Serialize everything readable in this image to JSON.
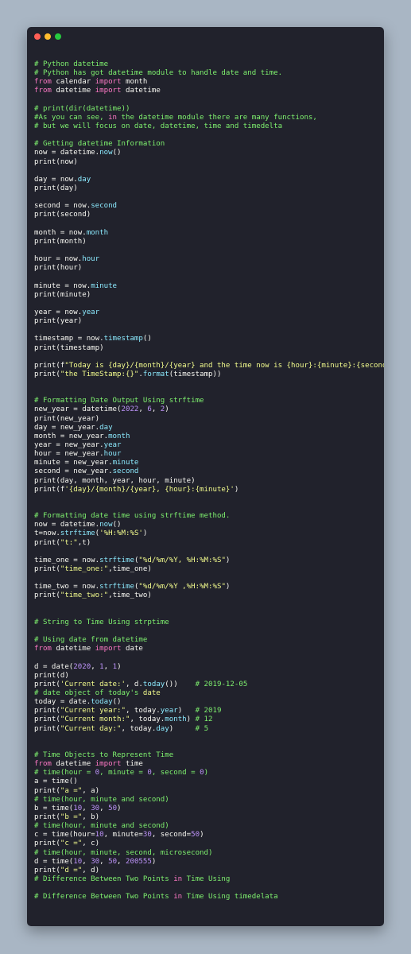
{
  "window": {
    "controls": [
      "close",
      "minimize",
      "maximize"
    ],
    "colors": {
      "background": "#21222c",
      "close": "#ff5f56",
      "minimize": "#ffbd2e",
      "maximize": "#27c93f",
      "comment": "#7ef06e",
      "keyword": "#ff79c6",
      "string": "#f1fa8c",
      "number": "#bd93f9",
      "attribute": "#8be9fd",
      "text": "#f8f8f2"
    }
  },
  "code_lines": [
    [
      [
        "c",
        "# Python datetime"
      ]
    ],
    [
      [
        "c",
        "# Python has got datetime module to handle date and time."
      ]
    ],
    [
      [
        "k",
        "from"
      ],
      [
        "p",
        " calendar "
      ],
      [
        "k",
        "import"
      ],
      [
        "p",
        " month"
      ]
    ],
    [
      [
        "k",
        "from"
      ],
      [
        "p",
        " datetime "
      ],
      [
        "k",
        "import"
      ],
      [
        "p",
        " datetime"
      ]
    ],
    [],
    [
      [
        "c",
        "# print(dir(datetime))"
      ]
    ],
    [
      [
        "c",
        "#As you can see, "
      ],
      [
        "k",
        "in"
      ],
      [
        "c",
        " the datetime module there are many functions,"
      ]
    ],
    [
      [
        "c",
        "# but we will focus on date, datetime, time and timedelta"
      ]
    ],
    [],
    [
      [
        "c",
        "# Getting datetime Information"
      ]
    ],
    [
      [
        "p",
        "now = datetime."
      ],
      [
        "a",
        "now"
      ],
      [
        "p",
        "()"
      ]
    ],
    [
      [
        "p",
        "print(now)"
      ]
    ],
    [],
    [
      [
        "p",
        "day = now."
      ],
      [
        "a",
        "day"
      ]
    ],
    [
      [
        "p",
        "print(day)"
      ]
    ],
    [],
    [
      [
        "p",
        "second = now."
      ],
      [
        "a",
        "second"
      ]
    ],
    [
      [
        "p",
        "print(second)"
      ]
    ],
    [],
    [
      [
        "p",
        "month = now."
      ],
      [
        "a",
        "month"
      ]
    ],
    [
      [
        "p",
        "print(month)"
      ]
    ],
    [],
    [
      [
        "p",
        "hour = now."
      ],
      [
        "a",
        "hour"
      ]
    ],
    [
      [
        "p",
        "print(hour)"
      ]
    ],
    [],
    [
      [
        "p",
        "minute = now."
      ],
      [
        "a",
        "minute"
      ]
    ],
    [
      [
        "p",
        "print(minute)"
      ]
    ],
    [],
    [
      [
        "p",
        "year = now."
      ],
      [
        "a",
        "year"
      ]
    ],
    [
      [
        "p",
        "print(year)"
      ]
    ],
    [],
    [
      [
        "p",
        "timestamp = now."
      ],
      [
        "a",
        "timestamp"
      ],
      [
        "p",
        "()"
      ]
    ],
    [
      [
        "p",
        "print(timestamp)"
      ]
    ],
    [],
    [
      [
        "p",
        "print(f"
      ],
      [
        "s",
        "\"Today is {day}/{month}/{year} and the time now is {hour}:{minute}:{second}\""
      ],
      [
        "p",
        ")"
      ]
    ],
    [
      [
        "p",
        "print("
      ],
      [
        "s",
        "\"the TimeStamp:{}\""
      ],
      [
        "p",
        "."
      ],
      [
        "a",
        "format"
      ],
      [
        "p",
        "(timestamp))"
      ]
    ],
    [],
    [],
    [
      [
        "c",
        "# Formatting Date Output Using strftime"
      ]
    ],
    [
      [
        "p",
        "new_year = datetime("
      ],
      [
        "n",
        "2022"
      ],
      [
        "p",
        ", "
      ],
      [
        "n",
        "6"
      ],
      [
        "p",
        ", "
      ],
      [
        "n",
        "2"
      ],
      [
        "p",
        ")"
      ]
    ],
    [
      [
        "p",
        "print(new_year)"
      ]
    ],
    [
      [
        "p",
        "day = new_year."
      ],
      [
        "a",
        "day"
      ]
    ],
    [
      [
        "p",
        "month = new_year."
      ],
      [
        "a",
        "month"
      ]
    ],
    [
      [
        "p",
        "year = new_year."
      ],
      [
        "a",
        "year"
      ]
    ],
    [
      [
        "p",
        "hour = new_year."
      ],
      [
        "a",
        "hour"
      ]
    ],
    [
      [
        "p",
        "minute = new_year."
      ],
      [
        "a",
        "minute"
      ]
    ],
    [
      [
        "p",
        "second = new_year."
      ],
      [
        "a",
        "second"
      ]
    ],
    [
      [
        "p",
        "print(day, month, year, hour, minute)"
      ]
    ],
    [
      [
        "p",
        "print(f"
      ],
      [
        "s",
        "'{day}/{month}/{year}, {hour}:{minute}'"
      ],
      [
        "p",
        ")"
      ]
    ],
    [],
    [],
    [
      [
        "c",
        "# Formatting date time using strftime method."
      ]
    ],
    [
      [
        "p",
        "now = datetime."
      ],
      [
        "a",
        "now"
      ],
      [
        "p",
        "()"
      ]
    ],
    [
      [
        "p",
        "t=now."
      ],
      [
        "a",
        "strftime"
      ],
      [
        "p",
        "("
      ],
      [
        "s",
        "'%H:%M:%S'"
      ],
      [
        "p",
        ")"
      ]
    ],
    [
      [
        "p",
        "print("
      ],
      [
        "s",
        "\"t:\""
      ],
      [
        "p",
        ",t)"
      ]
    ],
    [],
    [
      [
        "p",
        "time_one = now."
      ],
      [
        "a",
        "strftime"
      ],
      [
        "p",
        "("
      ],
      [
        "s",
        "\"%d/%m/%Y, %H:%M:%S\""
      ],
      [
        "p",
        ")"
      ]
    ],
    [
      [
        "p",
        "print("
      ],
      [
        "s",
        "\"time_one:\""
      ],
      [
        "p",
        ",time_one)"
      ]
    ],
    [],
    [
      [
        "p",
        "time_two = now."
      ],
      [
        "a",
        "strftime"
      ],
      [
        "p",
        "("
      ],
      [
        "s",
        "\"%d/%m/%Y ,%H:%M:%S\""
      ],
      [
        "p",
        ")"
      ]
    ],
    [
      [
        "p",
        "print("
      ],
      [
        "s",
        "\"time_two:\""
      ],
      [
        "p",
        ",time_two)"
      ]
    ],
    [],
    [],
    [
      [
        "c",
        "# String to Time Using strptime"
      ]
    ],
    [],
    [
      [
        "c",
        "# Using date from datetime"
      ]
    ],
    [
      [
        "k",
        "from"
      ],
      [
        "p",
        " datetime "
      ],
      [
        "k",
        "import"
      ],
      [
        "p",
        " date"
      ]
    ],
    [],
    [
      [
        "p",
        "d = date("
      ],
      [
        "n",
        "2020"
      ],
      [
        "p",
        ", "
      ],
      [
        "n",
        "1"
      ],
      [
        "p",
        ", "
      ],
      [
        "n",
        "1"
      ],
      [
        "p",
        ")"
      ]
    ],
    [
      [
        "p",
        "print(d)"
      ]
    ],
    [
      [
        "p",
        "print("
      ],
      [
        "s",
        "'Current date:'"
      ],
      [
        "p",
        ", d."
      ],
      [
        "a",
        "today"
      ],
      [
        "p",
        "())    "
      ],
      [
        "c",
        "# 2019-12-05"
      ]
    ],
    [
      [
        "c",
        "# date object of today's "
      ],
      [
        "s",
        "date"
      ]
    ],
    [
      [
        "p",
        "today = date."
      ],
      [
        "a",
        "today"
      ],
      [
        "p",
        "()"
      ]
    ],
    [
      [
        "p",
        "print("
      ],
      [
        "s",
        "\"Current year:\""
      ],
      [
        "p",
        ", today."
      ],
      [
        "a",
        "year"
      ],
      [
        "p",
        ")   "
      ],
      [
        "c",
        "# 2019"
      ]
    ],
    [
      [
        "p",
        "print("
      ],
      [
        "s",
        "\"Current month:\""
      ],
      [
        "p",
        ", today."
      ],
      [
        "a",
        "month"
      ],
      [
        "p",
        ") "
      ],
      [
        "c",
        "# 12"
      ]
    ],
    [
      [
        "p",
        "print("
      ],
      [
        "s",
        "\"Current day:\""
      ],
      [
        "p",
        ", today."
      ],
      [
        "a",
        "day"
      ],
      [
        "p",
        ")     "
      ],
      [
        "c",
        "# 5"
      ]
    ],
    [],
    [],
    [
      [
        "c",
        "# Time Objects to Represent Time"
      ]
    ],
    [
      [
        "k",
        "from"
      ],
      [
        "p",
        " datetime "
      ],
      [
        "k",
        "import"
      ],
      [
        "p",
        " time"
      ]
    ],
    [
      [
        "c",
        "# time(hour = "
      ],
      [
        "n",
        "0"
      ],
      [
        "c",
        ", minute = "
      ],
      [
        "n",
        "0"
      ],
      [
        "c",
        ", second = "
      ],
      [
        "n",
        "0"
      ],
      [
        "c",
        ")"
      ]
    ],
    [
      [
        "p",
        "a = time()"
      ]
    ],
    [
      [
        "p",
        "print("
      ],
      [
        "s",
        "\"a =\""
      ],
      [
        "p",
        ", a)"
      ]
    ],
    [
      [
        "c",
        "# time(hour, minute and second)"
      ]
    ],
    [
      [
        "p",
        "b = time("
      ],
      [
        "n",
        "10"
      ],
      [
        "p",
        ", "
      ],
      [
        "n",
        "30"
      ],
      [
        "p",
        ", "
      ],
      [
        "n",
        "50"
      ],
      [
        "p",
        ")"
      ]
    ],
    [
      [
        "p",
        "print("
      ],
      [
        "s",
        "\"b =\""
      ],
      [
        "p",
        ", b)"
      ]
    ],
    [
      [
        "c",
        "# time(hour, minute and second)"
      ]
    ],
    [
      [
        "p",
        "c = time(hour="
      ],
      [
        "n",
        "10"
      ],
      [
        "p",
        ", minute="
      ],
      [
        "n",
        "30"
      ],
      [
        "p",
        ", second="
      ],
      [
        "n",
        "50"
      ],
      [
        "p",
        ")"
      ]
    ],
    [
      [
        "p",
        "print("
      ],
      [
        "s",
        "\"c =\""
      ],
      [
        "p",
        ", c)"
      ]
    ],
    [
      [
        "c",
        "# time(hour, minute, second, microsecond)"
      ]
    ],
    [
      [
        "p",
        "d = time("
      ],
      [
        "n",
        "10"
      ],
      [
        "p",
        ", "
      ],
      [
        "n",
        "30"
      ],
      [
        "p",
        ", "
      ],
      [
        "n",
        "50"
      ],
      [
        "p",
        ", "
      ],
      [
        "n",
        "200555"
      ],
      [
        "p",
        ")"
      ]
    ],
    [
      [
        "p",
        "print("
      ],
      [
        "s",
        "\"d =\""
      ],
      [
        "p",
        ", d)"
      ]
    ],
    [
      [
        "c",
        "# Difference Between Two Points "
      ],
      [
        "k",
        "in"
      ],
      [
        "c",
        " Time Using"
      ]
    ],
    [],
    [
      [
        "c",
        "# Difference Between Two Points "
      ],
      [
        "k",
        "in"
      ],
      [
        "c",
        " Time Using timedelata"
      ]
    ]
  ]
}
